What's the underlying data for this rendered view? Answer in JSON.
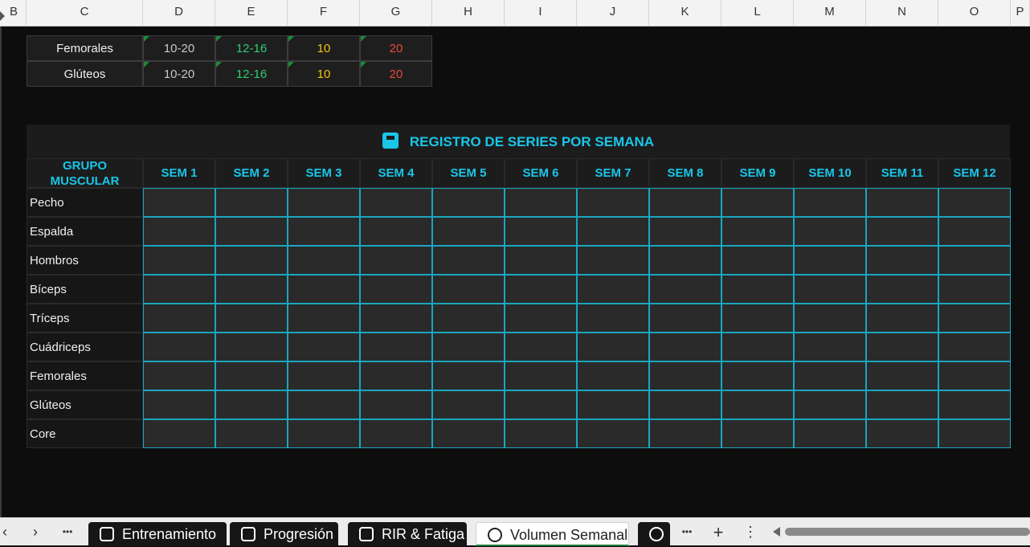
{
  "columns": [
    "B",
    "C",
    "D",
    "E",
    "F",
    "G",
    "H",
    "I",
    "J",
    "K",
    "L",
    "M",
    "N",
    "O",
    "P"
  ],
  "summary_rows": [
    {
      "muscle": "Femorales",
      "values": [
        "10-20",
        "12-16",
        "10",
        "20"
      ]
    },
    {
      "muscle": "Glúteos",
      "values": [
        "10-20",
        "12-16",
        "10",
        "20"
      ]
    }
  ],
  "summary_colors": [
    "#c8c8c8",
    "#2ecc71",
    "#f1c40f",
    "#e74c3c"
  ],
  "registro": {
    "title": "REGISTRO DE SERIES POR SEMANA",
    "icon": "calendar-icon",
    "group_header": "GRUPO MUSCULAR",
    "weeks": [
      "SEM 1",
      "SEM 2",
      "SEM 3",
      "SEM 4",
      "SEM 5",
      "SEM 6",
      "SEM 7",
      "SEM 8",
      "SEM 9",
      "SEM 10",
      "SEM 11",
      "SEM 12"
    ],
    "muscles": [
      "Pecho",
      "Espalda",
      "Hombros",
      "Bíceps",
      "Tríceps",
      "Cuádriceps",
      "Femorales",
      "Glúteos",
      "Core"
    ]
  },
  "tabs": [
    {
      "label": "Entrenamiento",
      "icon": "skull-icon",
      "active": false
    },
    {
      "label": "Progresión",
      "icon": "chart-icon",
      "active": false
    },
    {
      "label": "RIR & Fatiga",
      "icon": "target-icon",
      "active": false
    },
    {
      "label": "Volumen Semanal",
      "icon": "dumbbell-icon",
      "active": true
    }
  ],
  "tabbar": {
    "prev": "‹",
    "next": "›",
    "more": "•••",
    "add": "+",
    "menu": "⋮"
  },
  "accent": "#19c6e8"
}
